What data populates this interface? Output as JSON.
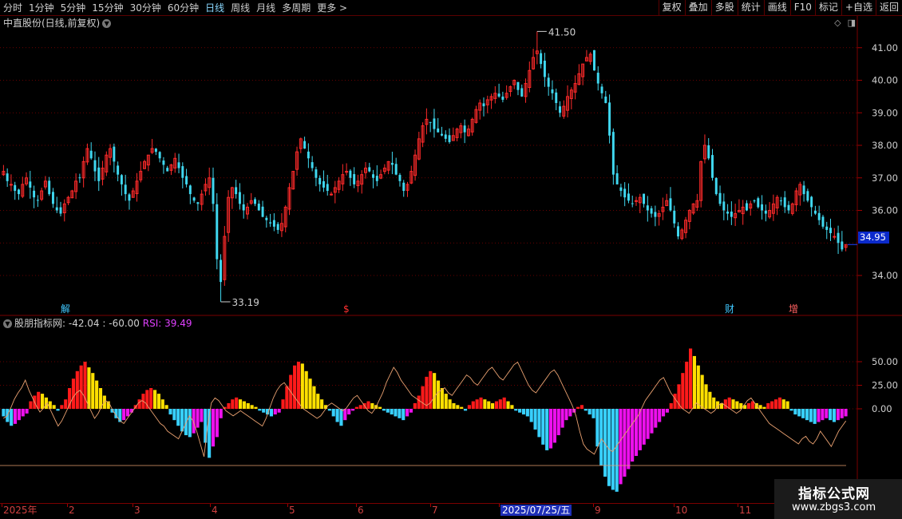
{
  "toolbar": {
    "periods": [
      "分时",
      "1分钟",
      "5分钟",
      "15分钟",
      "30分钟",
      "60分钟",
      "日线",
      "周线",
      "月线",
      "多周期",
      "更多 >"
    ],
    "active_period": "日线",
    "right_buttons": [
      "复权",
      "叠加",
      "多股",
      "统计",
      "画线",
      "F10",
      "标记",
      "+自选",
      "返回"
    ]
  },
  "price_pane": {
    "title": "中直股份(日线,前复权)",
    "high_label": "41.50",
    "low_label": "33.19",
    "last_price": "34.95",
    "y_ticks": [
      "41.00",
      "40.00",
      "39.00",
      "38.00",
      "37.00",
      "36.00",
      "34.00"
    ],
    "events": [
      {
        "text": "解",
        "color": "#40c8ff"
      },
      {
        "text": "$",
        "color": "#ff3030"
      },
      {
        "text": "财",
        "color": "#40c8ff"
      },
      {
        "text": "增",
        "color": "#ff6060"
      }
    ]
  },
  "indicator_pane": {
    "name": "股朋指标网",
    "value1": ": -42.04",
    "value2": ": -60.00",
    "rsi_label": "RSI: 39.49",
    "y_ticks": [
      "50.00",
      "25.00",
      "0.00"
    ]
  },
  "date_axis": {
    "labels": [
      "2025年",
      "2",
      "3",
      "4",
      "5",
      "6",
      "7",
      "2025/07/25/五",
      "9",
      "10",
      "11"
    ]
  },
  "watermark": {
    "line1": "指标公式网",
    "line2": "www.zbgs3.com"
  },
  "colors": {
    "up": "#ff2a2a",
    "down": "#40d8f0",
    "grid": "#8a0000",
    "bar_red": "#ff1a1a",
    "bar_yellow": "#ffe000",
    "bar_cyan": "#38d0ff",
    "bar_magenta": "#ee10ee",
    "rsi_line": "#e8a070"
  },
  "chart_data": {
    "type": "candlestick",
    "y_range": [
      33.19,
      41.5
    ],
    "closes": [
      37.2,
      36.9,
      36.8,
      36.6,
      36.5,
      36.8,
      37.0,
      36.7,
      36.4,
      36.3,
      36.6,
      36.9,
      36.5,
      36.2,
      36.0,
      35.9,
      36.2,
      36.4,
      36.6,
      36.9,
      37.0,
      37.5,
      37.9,
      37.6,
      37.2,
      36.9,
      37.3,
      37.7,
      37.9,
      37.5,
      37.1,
      36.8,
      36.5,
      36.3,
      36.6,
      36.9,
      37.2,
      37.5,
      37.7,
      37.9,
      37.8,
      37.6,
      37.4,
      37.2,
      37.4,
      37.6,
      37.3,
      37.0,
      36.8,
      36.5,
      36.3,
      36.2,
      36.5,
      36.8,
      37.0,
      36.2,
      34.5,
      33.8,
      35.2,
      36.4,
      36.7,
      36.5,
      36.2,
      36.0,
      36.1,
      36.3,
      36.2,
      36.0,
      35.8,
      35.7,
      35.6,
      35.5,
      35.4,
      35.6,
      36.1,
      36.7,
      37.2,
      37.8,
      38.2,
      37.9,
      37.6,
      37.3,
      37.0,
      36.8,
      36.7,
      36.6,
      36.5,
      36.7,
      36.9,
      37.1,
      37.2,
      37.0,
      36.8,
      36.9,
      37.1,
      37.3,
      37.2,
      37.0,
      36.9,
      37.1,
      37.3,
      37.5,
      37.4,
      37.1,
      36.9,
      36.6,
      36.8,
      37.2,
      37.7,
      38.2,
      38.6,
      38.8,
      38.7,
      38.5,
      38.4,
      38.3,
      38.2,
      38.1,
      38.3,
      38.5,
      38.6,
      38.4,
      38.5,
      38.8,
      39.1,
      39.3,
      39.2,
      39.4,
      39.5,
      39.6,
      39.5,
      39.4,
      39.6,
      39.8,
      40.0,
      39.7,
      39.5,
      39.9,
      40.3,
      40.7,
      40.9,
      40.5,
      40.1,
      39.8,
      39.6,
      39.3,
      39.0,
      39.2,
      39.5,
      39.7,
      39.9,
      40.2,
      40.5,
      40.7,
      40.8,
      40.3,
      39.9,
      39.6,
      39.3,
      38.3,
      37.1,
      36.8,
      36.6,
      36.4,
      36.3,
      36.2,
      36.3,
      36.4,
      36.2,
      36.0,
      35.9,
      35.8,
      35.9,
      36.1,
      36.3,
      36.0,
      35.6,
      35.2,
      35.4,
      35.7,
      36.0,
      36.2,
      36.3,
      37.5,
      38.0,
      37.6,
      37.0,
      36.5,
      36.2,
      36.0,
      35.9,
      35.8,
      35.9,
      36.0,
      36.1,
      36.0,
      36.2,
      36.3,
      36.1,
      36.0,
      35.9,
      36.0,
      36.2,
      36.4,
      36.3,
      36.1,
      36.0,
      36.2,
      36.6,
      36.8,
      36.5,
      36.3,
      36.1,
      35.9,
      35.7,
      35.5,
      35.4,
      35.3,
      35.2,
      35.0,
      34.8,
      34.95
    ],
    "indicator_bars": [
      -8,
      -14,
      -18,
      -16,
      -12,
      -8,
      -5,
      8,
      14,
      18,
      16,
      12,
      8,
      4,
      -2,
      4,
      10,
      22,
      32,
      40,
      46,
      50,
      44,
      38,
      30,
      22,
      14,
      8,
      -4,
      -10,
      -14,
      -12,
      -8,
      -4,
      4,
      10,
      16,
      20,
      22,
      20,
      16,
      10,
      4,
      -6,
      -12,
      -18,
      -24,
      -28,
      -30,
      -26,
      -20,
      -14,
      -36,
      -52,
      -40,
      -30,
      -10,
      2,
      6,
      10,
      12,
      10,
      8,
      6,
      4,
      2,
      -2,
      -4,
      -6,
      -8,
      -6,
      -4,
      10,
      24,
      36,
      46,
      50,
      48,
      40,
      32,
      24,
      16,
      10,
      4,
      -2,
      -8,
      -14,
      -18,
      -12,
      -6,
      -2,
      2,
      4,
      6,
      8,
      6,
      4,
      2,
      -2,
      -4,
      -6,
      -8,
      -10,
      -12,
      -8,
      -4,
      6,
      14,
      24,
      34,
      40,
      38,
      30,
      22,
      16,
      10,
      6,
      4,
      2,
      -2,
      4,
      8,
      10,
      12,
      10,
      8,
      6,
      8,
      10,
      12,
      8,
      4,
      -2,
      -4,
      -6,
      -8,
      -14,
      -22,
      -30,
      -38,
      -44,
      -42,
      -36,
      -28,
      -20,
      -12,
      -8,
      -4,
      2,
      4,
      -2,
      -6,
      -10,
      -40,
      -60,
      -72,
      -82,
      -86,
      -88,
      -80,
      -72,
      -64,
      -56,
      -50,
      -44,
      -38,
      -32,
      -26,
      -20,
      -14,
      -8,
      -4,
      6,
      16,
      26,
      38,
      50,
      64,
      56,
      46,
      36,
      26,
      18,
      12,
      8,
      6,
      10,
      12,
      10,
      8,
      6,
      4,
      6,
      8,
      6,
      4,
      2,
      6,
      8,
      10,
      12,
      10,
      8,
      -2,
      -6,
      -8,
      -10,
      -12,
      -14,
      -16,
      -14,
      -12,
      -10,
      -12,
      -14,
      -12,
      -10,
      -8
    ],
    "rsi": [
      40,
      42,
      48,
      55,
      60,
      64,
      70,
      62,
      56,
      50,
      45,
      48,
      52,
      46,
      40,
      34,
      38,
      44,
      50,
      56,
      60,
      62,
      58,
      52,
      46,
      40,
      44,
      50,
      54,
      52,
      46,
      42,
      38,
      36,
      40,
      44,
      48,
      52,
      54,
      52,
      48,
      44,
      40,
      36,
      34,
      30,
      28,
      26,
      24,
      30,
      36,
      42,
      38,
      30,
      20,
      10,
      34,
      52,
      56,
      54,
      50,
      46,
      44,
      42,
      44,
      46,
      44,
      42,
      40,
      38,
      36,
      34,
      40,
      48,
      56,
      62,
      66,
      68,
      64,
      60,
      56,
      52,
      48,
      46,
      44,
      42,
      40,
      42,
      46,
      50,
      52,
      50,
      48,
      46,
      48,
      52,
      56,
      58,
      54,
      50,
      46,
      44,
      48,
      54,
      60,
      68,
      74,
      80,
      76,
      70,
      66,
      62,
      58,
      56,
      54,
      52,
      50,
      52,
      56,
      60,
      62,
      64,
      60,
      58,
      62,
      66,
      70,
      74,
      72,
      68,
      66,
      70,
      74,
      78,
      80,
      76,
      72,
      70,
      74,
      78,
      82,
      84,
      78,
      72,
      66,
      62,
      60,
      64,
      68,
      72,
      76,
      78,
      74,
      68,
      62,
      56,
      50,
      42,
      30,
      20,
      16,
      14,
      12,
      18,
      24,
      20,
      16,
      14,
      18,
      22,
      26,
      30,
      34,
      38,
      42,
      48,
      54,
      58,
      62,
      66,
      70,
      72,
      66,
      60,
      56,
      52,
      48,
      46,
      44,
      48,
      52,
      50,
      48,
      46,
      44,
      46,
      50,
      52,
      50,
      48,
      46,
      44,
      46,
      50,
      54,
      56,
      52,
      48,
      44,
      40,
      36,
      34,
      32,
      30,
      28,
      26,
      24,
      22,
      20,
      24,
      26,
      22,
      20,
      24,
      30,
      26,
      22,
      18,
      24,
      30,
      34,
      38
    ]
  }
}
